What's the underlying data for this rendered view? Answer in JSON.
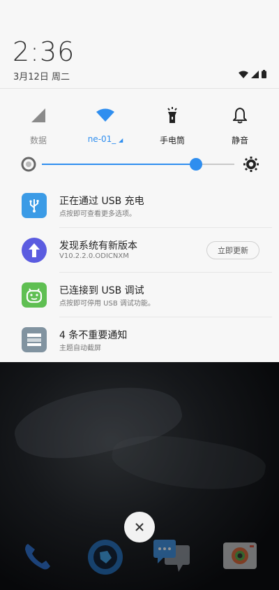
{
  "header": {
    "time": "2:36",
    "date": "3月12日 周二"
  },
  "quick_settings": [
    {
      "id": "data",
      "label": "数据",
      "icon": "signal-icon",
      "active": false
    },
    {
      "id": "wifi",
      "label": "ne-01_",
      "icon": "wifi-icon",
      "active": true
    },
    {
      "id": "flashlight",
      "label": "手电筒",
      "icon": "flashlight-icon",
      "active": false
    },
    {
      "id": "silent",
      "label": "静音",
      "icon": "bell-icon",
      "active": false
    }
  ],
  "brightness": {
    "level": 0.8
  },
  "notifications": [
    {
      "title": "正在通过 USB 充电",
      "subtitle": "点按即可查看更多选项。",
      "icon": "usb-icon",
      "color": "#3b9be6"
    },
    {
      "title": "发现系统有新版本",
      "subtitle": "V10.2.2.0.ODICNXM",
      "icon": "update-arrow-icon",
      "color": "#5b5ce0",
      "action": "立即更新"
    },
    {
      "title": "已连接到 USB 调试",
      "subtitle": "点按即可停用 USB 调试功能。",
      "icon": "android-icon",
      "color": "#5fbf52"
    },
    {
      "title": "4 条不重要通知",
      "subtitle": "主题自动截屏",
      "icon": "stack-icon",
      "color": "#8193a0"
    }
  ],
  "colors": {
    "accent": "#2f8eef",
    "shade_bg": "#f7f7f7"
  }
}
